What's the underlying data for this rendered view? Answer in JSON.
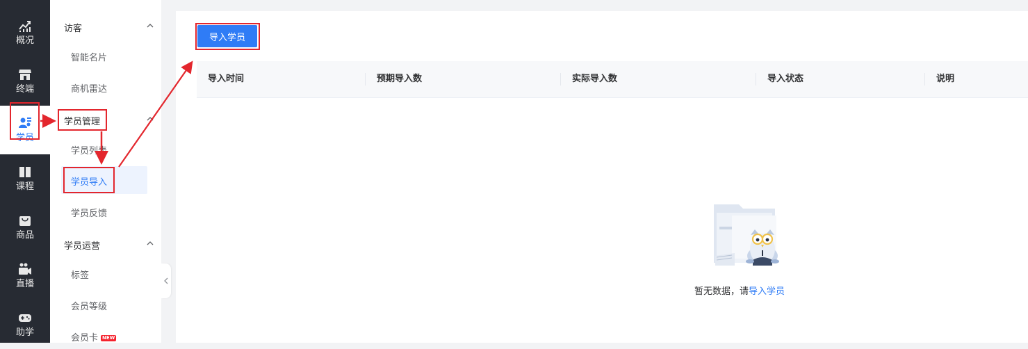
{
  "rail": [
    {
      "label": "概况",
      "icon": "chart-up-icon"
    },
    {
      "label": "终端",
      "icon": "store-icon"
    },
    {
      "label": "学员",
      "icon": "users-icon",
      "active": true
    },
    {
      "label": "课程",
      "icon": "book-icon"
    },
    {
      "label": "商品",
      "icon": "bag-icon"
    },
    {
      "label": "直播",
      "icon": "video-camera-icon"
    },
    {
      "label": "助学",
      "icon": "gamepad-icon"
    }
  ],
  "submenu": {
    "visitor_group": "访客",
    "visitor_items": [
      "智能名片",
      "商机雷达"
    ],
    "student_mgmt_group": "学员管理",
    "student_mgmt_items": [
      "学员列表",
      "学员导入",
      "学员反馈"
    ],
    "student_ops_group": "学员运营",
    "student_ops_items": [
      "标签",
      "会员等级",
      "会员卡"
    ],
    "new_badge": "NEW"
  },
  "main": {
    "import_button": "导入学员",
    "columns": [
      "导入时间",
      "预期导入数",
      "实际导入数",
      "导入状态",
      "说明"
    ],
    "empty_text": "暂无数据，请",
    "empty_link": "导入学员"
  },
  "colors": {
    "accent": "#2f7cf6",
    "rail_bg": "#272b33",
    "annotation_red": "#e3262d"
  }
}
